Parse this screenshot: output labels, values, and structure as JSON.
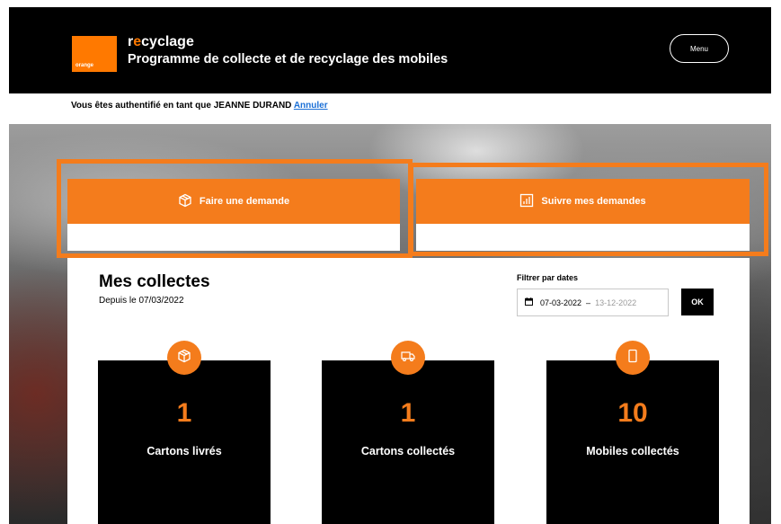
{
  "header": {
    "logo_text": "orange",
    "brand_prefix": "r",
    "brand_accent": "e",
    "brand_rest": "cyclage",
    "tagline": "Programme de collecte et de recyclage des mobiles",
    "menu_label": "Menu"
  },
  "auth": {
    "text": "Vous êtes authentifié en tant que JEANNE DURAND ",
    "cancel_label": "Annuler"
  },
  "actions": {
    "request_label": "Faire une demande",
    "request_icon": "box-icon",
    "track_label": "Suivre mes demandes",
    "track_icon": "chart-icon"
  },
  "collections": {
    "title": "Mes collectes",
    "since": "Depuis le 07/03/2022",
    "filter_label": "Filtrer par dates",
    "date_start": "07-03-2022",
    "date_separator": "–",
    "date_end": "13-12-2022",
    "ok_label": "OK"
  },
  "stats": [
    {
      "value": "1",
      "label": "Cartons livrés",
      "icon": "box-icon"
    },
    {
      "value": "1",
      "label": "Cartons collectés",
      "icon": "truck-icon"
    },
    {
      "value": "10",
      "label": "Mobiles collectés",
      "icon": "phone-icon"
    }
  ],
  "colors": {
    "accent": "#f47c1c",
    "brand_orange": "#ff7900",
    "dark": "#000000",
    "link": "#1a6fd6"
  }
}
